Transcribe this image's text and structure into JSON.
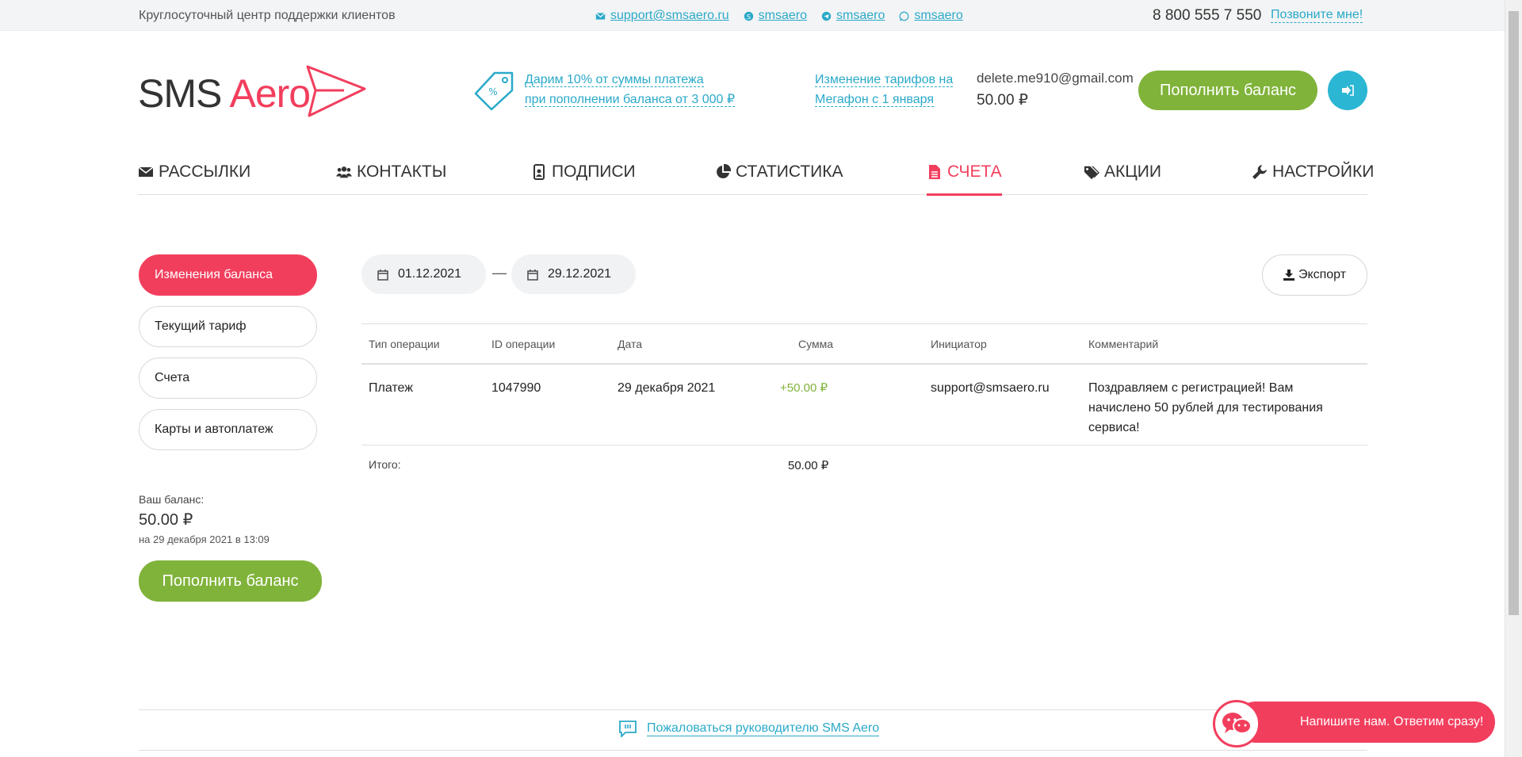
{
  "topbar": {
    "support_text": "Круглосуточный центр поддержки клиентов",
    "email": "support@smsaero.ru",
    "skype": "smsaero",
    "telegram": "smsaero",
    "whatsapp": "smsaero",
    "phone": "8 800 555 7 550",
    "callme": "Позвоните мне!"
  },
  "logo": {
    "part1": "SMS",
    "part2": "Aero"
  },
  "promo": {
    "line1": "Дарим 10% от суммы платежа",
    "line2": "при пополнении баланса от 3 000 ₽"
  },
  "news": {
    "line1": "Изменение тарифов на",
    "line2": "Мегафон с 1 января"
  },
  "account": {
    "email": "delete.me910@gmail.com",
    "balance": "50.00 ₽",
    "topup_label": "Пополнить баланс"
  },
  "nav": {
    "items": [
      {
        "label": "РАССЫЛКИ",
        "icon": "envelope-icon"
      },
      {
        "label": "КОНТАКТЫ",
        "icon": "users-icon"
      },
      {
        "label": "ПОДПИСИ",
        "icon": "badge-icon"
      },
      {
        "label": "СТАТИСТИКА",
        "icon": "pie-chart-icon"
      },
      {
        "label": "СЧЕТА",
        "icon": "file-icon"
      },
      {
        "label": "АКЦИИ",
        "icon": "tags-icon"
      },
      {
        "label": "НАСТРОЙКИ",
        "icon": "wrench-icon"
      }
    ],
    "active": "СЧЕТА"
  },
  "sidebar": {
    "items": [
      {
        "label": "Изменения баланса"
      },
      {
        "label": "Текущий тариф"
      },
      {
        "label": "Счета"
      },
      {
        "label": "Карты и автоплатеж"
      }
    ],
    "balance_label": "Ваш баланс:",
    "balance_value": "50.00 ₽",
    "balance_date": "на 29 декабря 2021 в 13:09",
    "topup_label": "Пополнить баланс"
  },
  "filter": {
    "date_from": "01.12.2021",
    "date_to": "29.12.2021",
    "separator": "—",
    "export_label": "Экспорт"
  },
  "table": {
    "columns": [
      "Тип операции",
      "ID операции",
      "Дата",
      "Сумма",
      "Инициатор",
      "Комментарий"
    ],
    "rows": [
      {
        "type": "Платеж",
        "id": "1047990",
        "date": "29 декабря 2021",
        "amount": "+50.00 ₽",
        "initiator": "support@smsaero.ru",
        "comment_line1": "Поздравляем с регистрацией! Вам",
        "comment_line2": "начислено 50 рублей для тестирования",
        "comment_line3": "сервиса!"
      }
    ],
    "total_label": "Итого:",
    "total_value": "50.00 ₽"
  },
  "footer": {
    "complaint": "Пожаловаться руководителю SMS Aero"
  },
  "chat": {
    "label": "Напишите нам. Ответим сразу!"
  },
  "colors": {
    "accent_red": "#f23e5d",
    "accent_green": "#80b33a",
    "link_blue": "#2aa9c9"
  }
}
